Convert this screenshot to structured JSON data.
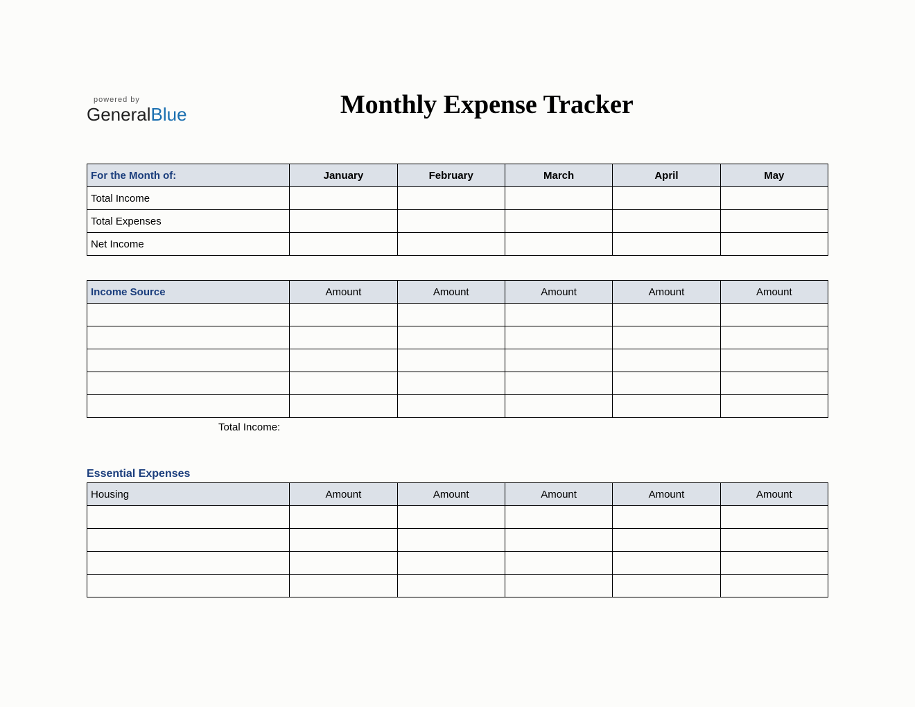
{
  "logo": {
    "powered_by": "powered by",
    "brand_general": "General",
    "brand_blue": "Blue"
  },
  "title": "Monthly Expense Tracker",
  "summary_table": {
    "row_header": "For the Month of:",
    "months": [
      "January",
      "February",
      "March",
      "April",
      "May"
    ],
    "rows": [
      "Total Income",
      "Total Expenses",
      "Net Income"
    ]
  },
  "income_table": {
    "header": "Income Source",
    "col_header": "Amount",
    "row_count": 5,
    "total_label": "Total Income:"
  },
  "expenses": {
    "section_title": "Essential Expenses",
    "housing": {
      "header": "Housing",
      "col_header": "Amount",
      "row_count": 4
    }
  }
}
